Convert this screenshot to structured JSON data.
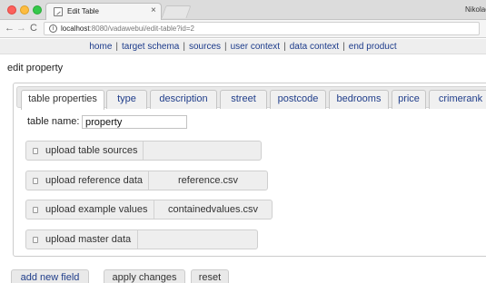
{
  "browser": {
    "tab_title": "Edit Table",
    "tab_close": "×",
    "profile": "Nikolao",
    "url_host": "localhost",
    "url_rest": ":8080/vadawebui/edit-table?id=2",
    "icons": [
      "back-arrow-icon",
      "forward-arrow-icon",
      "reload-icon",
      "info-icon",
      "star-icon"
    ]
  },
  "topnav": {
    "items": [
      "home",
      "target schema",
      "sources",
      "user context",
      "data context",
      "end product"
    ],
    "separator": "|"
  },
  "page": {
    "title": "edit property"
  },
  "tabs": [
    "table properties",
    "type",
    "description",
    "street",
    "postcode",
    "bedrooms",
    "price",
    "crimerank"
  ],
  "table_name": {
    "label": "table name:",
    "value": "property"
  },
  "uploads": [
    {
      "label": "upload table sources",
      "file": ""
    },
    {
      "label": "upload reference data",
      "file": "reference.csv"
    },
    {
      "label": "upload example values",
      "file": "containedvalues.csv"
    },
    {
      "label": "upload master data",
      "file": ""
    }
  ],
  "actions": {
    "add": "add new field",
    "apply": "apply changes",
    "reset": "reset"
  }
}
